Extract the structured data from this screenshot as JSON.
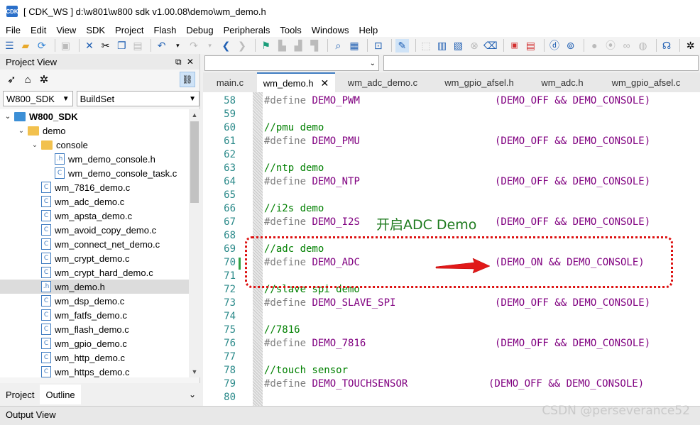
{
  "window": {
    "title": "[ CDK_WS ] d:\\w801\\w800 sdk v1.00.08\\demo\\wm_demo.h",
    "icon_text": "CDK"
  },
  "menu": [
    "File",
    "Edit",
    "View",
    "SDK",
    "Project",
    "Flash",
    "Debug",
    "Peripherals",
    "Tools",
    "Windows",
    "Help"
  ],
  "project_view": {
    "title": "Project View",
    "window_controls": "⧉ ✕",
    "solution": "W800_SDK",
    "build_set": "BuildSet",
    "tree": [
      {
        "label": "W800_SDK",
        "indent": 0,
        "kind": "project",
        "expanded": true,
        "bold": true
      },
      {
        "label": "demo",
        "indent": 1,
        "kind": "folder",
        "expanded": true
      },
      {
        "label": "console",
        "indent": 2,
        "kind": "folder",
        "expanded": true
      },
      {
        "label": "wm_demo_console.h",
        "indent": 3,
        "kind": "h"
      },
      {
        "label": "wm_demo_console_task.c",
        "indent": 3,
        "kind": "c"
      },
      {
        "label": "wm_7816_demo.c",
        "indent": 2,
        "kind": "c"
      },
      {
        "label": "wm_adc_demo.c",
        "indent": 2,
        "kind": "c"
      },
      {
        "label": "wm_apsta_demo.c",
        "indent": 2,
        "kind": "c"
      },
      {
        "label": "wm_avoid_copy_demo.c",
        "indent": 2,
        "kind": "c"
      },
      {
        "label": "wm_connect_net_demo.c",
        "indent": 2,
        "kind": "c"
      },
      {
        "label": "wm_crypt_demo.c",
        "indent": 2,
        "kind": "c"
      },
      {
        "label": "wm_crypt_hard_demo.c",
        "indent": 2,
        "kind": "c"
      },
      {
        "label": "wm_demo.h",
        "indent": 2,
        "kind": "h",
        "selected": true
      },
      {
        "label": "wm_dsp_demo.c",
        "indent": 2,
        "kind": "c"
      },
      {
        "label": "wm_fatfs_demo.c",
        "indent": 2,
        "kind": "c"
      },
      {
        "label": "wm_flash_demo.c",
        "indent": 2,
        "kind": "c"
      },
      {
        "label": "wm_gpio_demo.c",
        "indent": 2,
        "kind": "c"
      },
      {
        "label": "wm_http_demo.c",
        "indent": 2,
        "kind": "c"
      },
      {
        "label": "wm_https_demo.c",
        "indent": 2,
        "kind": "c"
      }
    ],
    "bottom_tabs": [
      "Project",
      "Outline"
    ]
  },
  "editor": {
    "tabs": [
      {
        "label": "main.c",
        "active": false
      },
      {
        "label": "wm_demo.h",
        "active": true
      },
      {
        "label": "wm_adc_demo.c",
        "active": false
      },
      {
        "label": "wm_gpio_afsel.h",
        "active": false
      },
      {
        "label": "wm_adc.h",
        "active": false
      },
      {
        "label": "wm_gpio_afsel.c",
        "active": false
      }
    ],
    "lines": [
      {
        "n": "58",
        "kind": "define",
        "name": "DEMO_PWM",
        "value": "(DEMO_OFF && DEMO_CONSOLE)"
      },
      {
        "n": "59",
        "kind": "blank"
      },
      {
        "n": "60",
        "kind": "comment",
        "text": "//pmu demo"
      },
      {
        "n": "61",
        "kind": "define",
        "name": "DEMO_PMU",
        "value": "(DEMO_OFF && DEMO_CONSOLE)"
      },
      {
        "n": "62",
        "kind": "blank"
      },
      {
        "n": "63",
        "kind": "comment",
        "text": "//ntp demo"
      },
      {
        "n": "64",
        "kind": "define",
        "name": "DEMO_NTP",
        "value": "(DEMO_OFF && DEMO_CONSOLE)"
      },
      {
        "n": "65",
        "kind": "blank"
      },
      {
        "n": "66",
        "kind": "comment",
        "text": "//i2s demo"
      },
      {
        "n": "67",
        "kind": "define",
        "name": "DEMO_I2S",
        "value": "(DEMO_OFF && DEMO_CONSOLE)"
      },
      {
        "n": "68",
        "kind": "blank"
      },
      {
        "n": "69",
        "kind": "comment",
        "text": "//adc demo"
      },
      {
        "n": "70",
        "kind": "define",
        "name": "DEMO_ADC",
        "value": "(DEMO_ON && DEMO_CONSOLE)",
        "changed": true
      },
      {
        "n": "71",
        "kind": "blank"
      },
      {
        "n": "72",
        "kind": "comment",
        "text": "//slave spi demo"
      },
      {
        "n": "73",
        "kind": "define",
        "name": "DEMO_SLAVE_SPI",
        "value": "(DEMO_OFF && DEMO_CONSOLE)"
      },
      {
        "n": "74",
        "kind": "blank"
      },
      {
        "n": "75",
        "kind": "comment",
        "text": "//7816"
      },
      {
        "n": "76",
        "kind": "define",
        "name": "DEMO_7816",
        "value": "(DEMO_OFF && DEMO_CONSOLE)"
      },
      {
        "n": "77",
        "kind": "blank"
      },
      {
        "n": "78",
        "kind": "comment",
        "text": "//touch sensor"
      },
      {
        "n": "79",
        "kind": "define",
        "name": "DEMO_TOUCHSENSOR",
        "value": "(DEMO_OFF && DEMO_CONSOLE)"
      },
      {
        "n": "80",
        "kind": "blank"
      }
    ],
    "annotation": "开启ADC Demo"
  },
  "output_view": {
    "title": "Output View"
  },
  "watermark": "CSDN @perseverance52"
}
